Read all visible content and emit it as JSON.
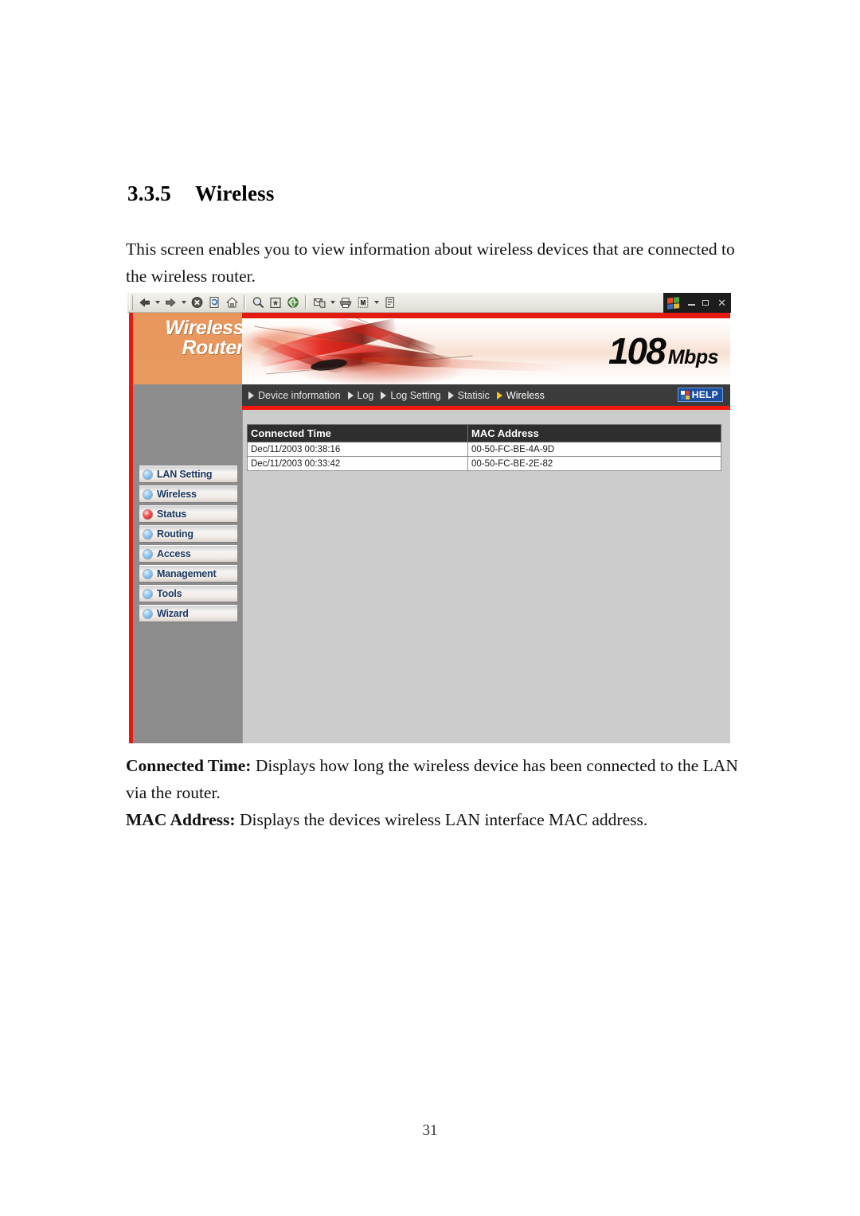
{
  "document": {
    "heading_number": "3.3.5",
    "heading_title": "Wireless",
    "intro": "This screen enables you to view information about wireless devices that are connected to the wireless router.",
    "desc_connected_time_term": "Connected Time:",
    "desc_connected_time_text": " Displays how long the wireless device has been connected to the LAN via the router.",
    "desc_mac_term": "MAC Address:",
    "desc_mac_text": " Displays the devices wireless LAN interface MAC address.",
    "page_number": "31"
  },
  "browser": {
    "toolbar": {
      "buttons": [
        {
          "name": "back-button",
          "glyph": "⇦",
          "has_dropdown": true
        },
        {
          "name": "forward-button",
          "glyph": "⇨",
          "has_dropdown": true
        },
        {
          "name": "stop-button",
          "glyph": "⊗",
          "has_dropdown": false
        },
        {
          "name": "refresh-button",
          "glyph": "↻",
          "has_dropdown": false
        },
        {
          "name": "home-button",
          "glyph": "⌂",
          "has_dropdown": false
        },
        {
          "name": "search-button",
          "glyph": "⌕",
          "has_dropdown": false
        },
        {
          "name": "favorites-button",
          "glyph": "★",
          "has_dropdown": false
        },
        {
          "name": "history-button",
          "glyph": "◔",
          "has_dropdown": false
        },
        {
          "name": "mail-button",
          "glyph": "✉",
          "has_dropdown": true
        },
        {
          "name": "print-button",
          "glyph": "⎙",
          "has_dropdown": false
        },
        {
          "name": "edit-button",
          "glyph": "▤",
          "has_dropdown": true
        },
        {
          "name": "discuss-button",
          "glyph": "≡",
          "has_dropdown": false
        }
      ]
    },
    "window_controls": {
      "logo": "windows-logo",
      "minimize": "–",
      "restore": "❐",
      "close": "✕"
    }
  },
  "router_ui": {
    "brand": {
      "line1": "Wireless",
      "line2": "Router"
    },
    "banner": {
      "speed_number": "108",
      "speed_unit": "Mbps"
    },
    "nav": {
      "items": [
        {
          "label": "Device information",
          "active": false
        },
        {
          "label": "Log",
          "active": false
        },
        {
          "label": "Log Setting",
          "active": false
        },
        {
          "label": "Statisic",
          "active": false
        },
        {
          "label": "Wireless",
          "active": true
        }
      ],
      "help_label": "HELP"
    },
    "sidebar": {
      "items": [
        {
          "label": "LAN Setting",
          "active": false
        },
        {
          "label": "Wireless",
          "active": false
        },
        {
          "label": "Status",
          "active": true
        },
        {
          "label": "Routing",
          "active": false
        },
        {
          "label": "Access",
          "active": false
        },
        {
          "label": "Management",
          "active": false
        },
        {
          "label": "Tools",
          "active": false
        },
        {
          "label": "Wizard",
          "active": false
        }
      ]
    },
    "table": {
      "columns": [
        "Connected Time",
        "MAC Address"
      ],
      "rows": [
        [
          "Dec/11/2003 00:38:16",
          "00-50-FC-BE-4A-9D"
        ],
        [
          "Dec/11/2003 00:33:42",
          "00-50-FC-BE-2E-82"
        ]
      ]
    }
  },
  "colors": {
    "brand_red": "#e21a10",
    "nav_bar": "#3b3b3b",
    "content_bg": "#cccccc",
    "sidebar_bg": "#8c8c8c",
    "menu_text": "#1d3a63",
    "help_blue": "#1a4fa0",
    "active_arrow": "#f5c518"
  }
}
